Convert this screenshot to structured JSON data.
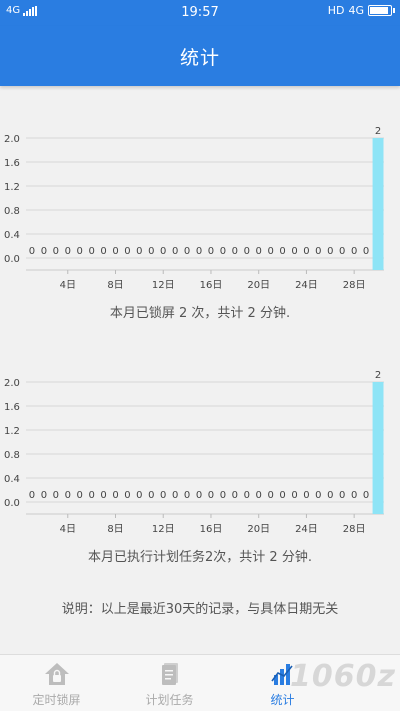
{
  "status_bar": {
    "network": "4G",
    "time": "19:57",
    "hd": "HD",
    "network_right": "4G"
  },
  "header": {
    "title": "统计"
  },
  "chart_data": [
    {
      "type": "bar",
      "x": [
        1,
        2,
        3,
        4,
        5,
        6,
        7,
        8,
        9,
        10,
        11,
        12,
        13,
        14,
        15,
        16,
        17,
        18,
        19,
        20,
        21,
        22,
        23,
        24,
        25,
        26,
        27,
        28,
        29,
        30
      ],
      "values": [
        0,
        0,
        0,
        0,
        0,
        0,
        0,
        0,
        0,
        0,
        0,
        0,
        0,
        0,
        0,
        0,
        0,
        0,
        0,
        0,
        0,
        0,
        0,
        0,
        0,
        0,
        0,
        0,
        0,
        2
      ],
      "ylim": [
        0,
        2.0
      ],
      "yticks": [
        "0.0",
        "0.4",
        "0.8",
        "1.2",
        "1.6",
        "2.0"
      ],
      "xticks": [
        {
          "v": 4,
          "label": "4日"
        },
        {
          "v": 8,
          "label": "8日"
        },
        {
          "v": 12,
          "label": "12日"
        },
        {
          "v": 16,
          "label": "16日"
        },
        {
          "v": 20,
          "label": "20日"
        },
        {
          "v": 24,
          "label": "24日"
        },
        {
          "v": 28,
          "label": "28日"
        }
      ],
      "grid": true,
      "bar_color": "#8ee4f6"
    },
    {
      "type": "bar",
      "x": [
        1,
        2,
        3,
        4,
        5,
        6,
        7,
        8,
        9,
        10,
        11,
        12,
        13,
        14,
        15,
        16,
        17,
        18,
        19,
        20,
        21,
        22,
        23,
        24,
        25,
        26,
        27,
        28,
        29,
        30
      ],
      "values": [
        0,
        0,
        0,
        0,
        0,
        0,
        0,
        0,
        0,
        0,
        0,
        0,
        0,
        0,
        0,
        0,
        0,
        0,
        0,
        0,
        0,
        0,
        0,
        0,
        0,
        0,
        0,
        0,
        0,
        2
      ],
      "ylim": [
        0,
        2.0
      ],
      "yticks": [
        "0.0",
        "0.4",
        "0.8",
        "1.2",
        "1.6",
        "2.0"
      ],
      "xticks": [
        {
          "v": 4,
          "label": "4日"
        },
        {
          "v": 8,
          "label": "8日"
        },
        {
          "v": 12,
          "label": "12日"
        },
        {
          "v": 16,
          "label": "16日"
        },
        {
          "v": 20,
          "label": "20日"
        },
        {
          "v": 24,
          "label": "24日"
        },
        {
          "v": 28,
          "label": "28日"
        }
      ],
      "grid": true,
      "bar_color": "#8ee4f6"
    }
  ],
  "captions": {
    "lock": "本月已锁屏 2 次，共计 2 分钟.",
    "plan": "本月已执行计划任务2次，共计 2 分钟."
  },
  "note": "说明：以上是最近30天的记录，与具体日期无关",
  "nav": [
    {
      "label": "定时锁屏",
      "icon": "home-lock-icon"
    },
    {
      "label": "计划任务",
      "icon": "document-icon"
    },
    {
      "label": "统计",
      "icon": "bar-chart-icon"
    }
  ],
  "watermark": "1060z"
}
